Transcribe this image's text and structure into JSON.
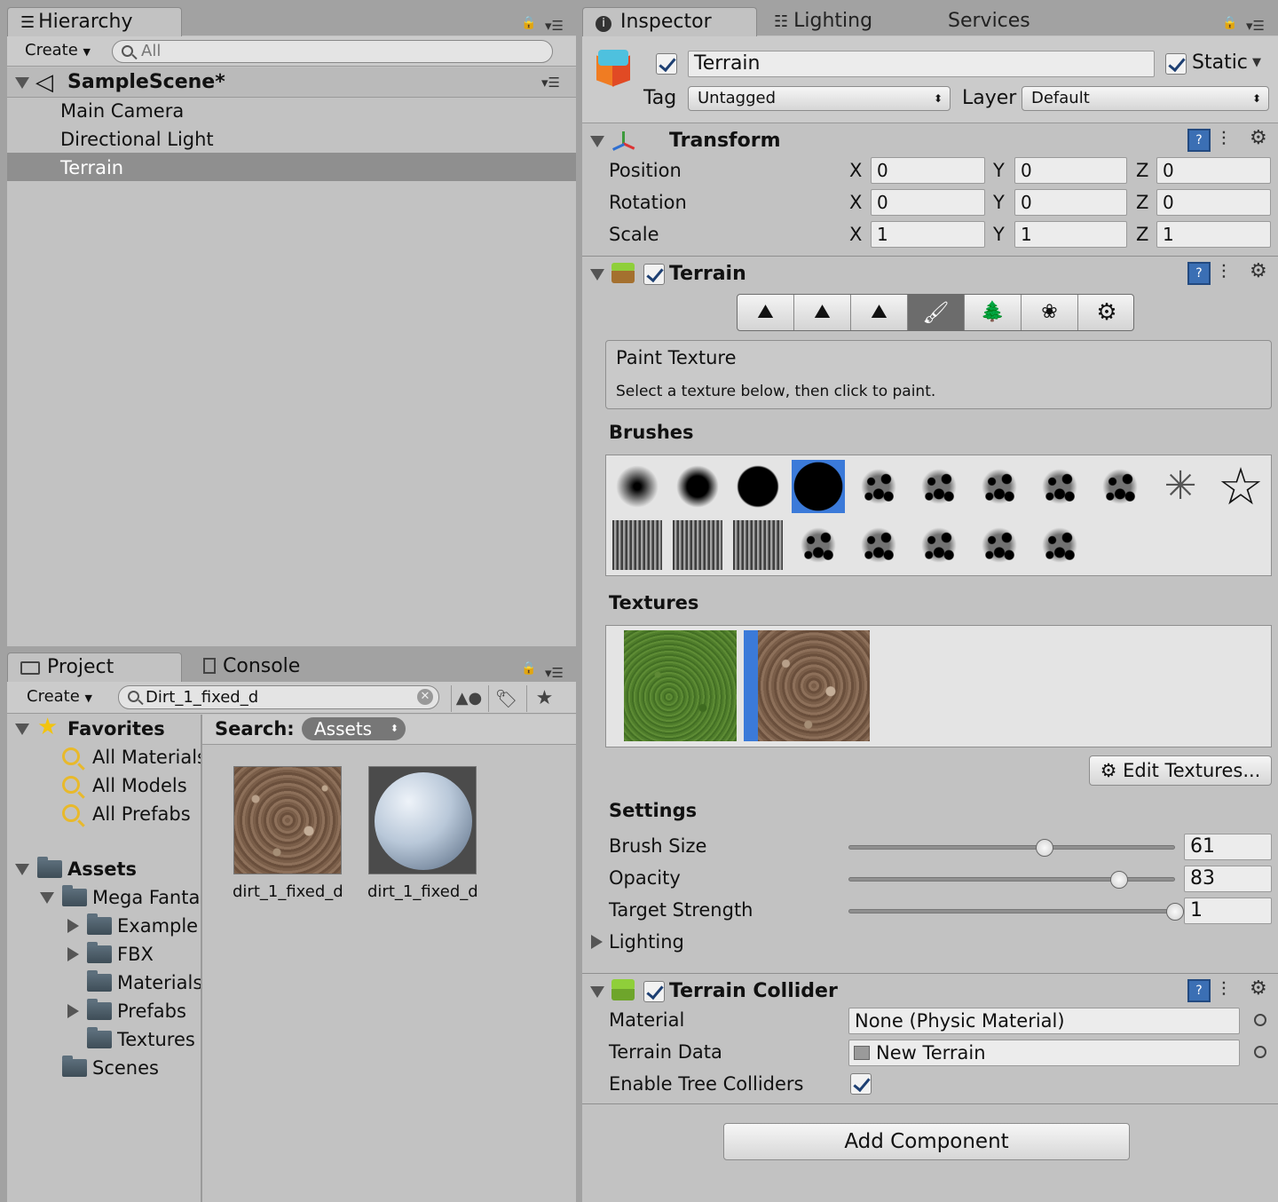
{
  "hierarchy": {
    "tab_label": "Hierarchy",
    "create_label": "Create",
    "search_placeholder": "All",
    "scene_name": "SampleScene*",
    "items": [
      {
        "label": "Main Camera"
      },
      {
        "label": "Directional Light"
      },
      {
        "label": "Terrain"
      }
    ]
  },
  "project": {
    "tab_label": "Project",
    "console_tab_label": "Console",
    "create_label": "Create",
    "search_value": "Dirt_1_fixed_d",
    "search_label": "Search:",
    "search_scope": "Assets",
    "favorites_label": "Favorites",
    "favorites": [
      "All Materials",
      "All Models",
      "All Prefabs"
    ],
    "assets_label": "Assets",
    "tree": [
      {
        "label": "Mega Fanta"
      },
      {
        "label": "Example"
      },
      {
        "label": "FBX"
      },
      {
        "label": "Materials"
      },
      {
        "label": "Prefabs"
      },
      {
        "label": "Textures"
      },
      {
        "label": "Scenes"
      }
    ],
    "results": [
      {
        "label": "dirt_1_fixed_d"
      },
      {
        "label": "dirt_1_fixed_d"
      }
    ]
  },
  "inspector": {
    "tab_label": "Inspector",
    "lighting_tab_label": "Lighting",
    "services_tab_label": "Services",
    "object_name": "Terrain",
    "static_label": "Static",
    "tag_label": "Tag",
    "tag_value": "Untagged",
    "layer_label": "Layer",
    "layer_value": "Default",
    "transform": {
      "title": "Transform",
      "axis": {
        "x": "X",
        "y": "Y",
        "z": "Z"
      },
      "rows": [
        {
          "label": "Position",
          "x": "0",
          "y": "0",
          "z": "0"
        },
        {
          "label": "Rotation",
          "x": "0",
          "y": "0",
          "z": "0"
        },
        {
          "label": "Scale",
          "x": "1",
          "y": "1",
          "z": "1"
        }
      ]
    },
    "terrain": {
      "title": "Terrain",
      "paint_title": "Paint Texture",
      "paint_hint": "Select a texture below, then click to paint.",
      "brushes_label": "Brushes",
      "textures_label": "Textures",
      "edit_textures_label": "Edit Textures...",
      "settings_label": "Settings",
      "brush_size_label": "Brush Size",
      "brush_size_value": "61",
      "brush_size_fraction": 0.6,
      "opacity_label": "Opacity",
      "opacity_value": "83",
      "opacity_fraction": 0.83,
      "target_strength_label": "Target Strength",
      "target_strength_value": "1",
      "target_strength_fraction": 1.0,
      "lighting_label": "Lighting"
    },
    "collider": {
      "title": "Terrain Collider",
      "material_label": "Material",
      "material_value": "None (Physic Material)",
      "terrain_data_label": "Terrain Data",
      "terrain_data_value": "New Terrain",
      "enable_trees_label": "Enable Tree Colliders"
    },
    "add_component_label": "Add Component"
  },
  "colors": {
    "panel_bg": "#c2c2c2",
    "selection": "#8f8f8f",
    "accent_blue": "#3b7ad9"
  }
}
